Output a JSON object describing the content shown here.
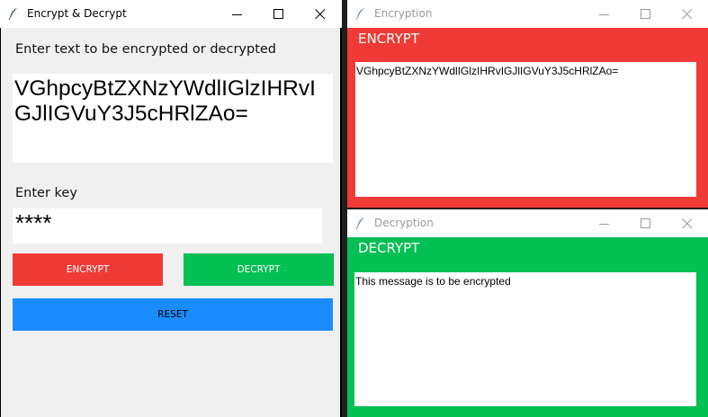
{
  "main_window": {
    "title": "Encrypt & Decrypt",
    "text_label": "Enter text to be encrypted or decrypted",
    "text_value": "VGhpcyBtZXNzYWdlIGlzIHRvIGJlIGVuY3J5cHRlZAo=",
    "key_label": "Enter key",
    "key_value": "****",
    "encrypt_button": "ENCRYPT",
    "decrypt_button": "DECRYPT",
    "reset_button": "RESET"
  },
  "encryption_window": {
    "title": "Encryption",
    "heading": "ENCRYPT",
    "result": "VGhpcyBtZXNzYWdlIGlzIHRvIGJlIGVuY3J5cHRlZAo="
  },
  "decryption_window": {
    "title": "Decryption",
    "heading": "DECRYPT",
    "result": "This message is to be encrypted"
  },
  "colors": {
    "encrypt": "#ef3a36",
    "decrypt": "#03bf54",
    "reset": "#1a8cff",
    "window_bg": "#f0f0f0"
  },
  "icons": [
    "feather-icon",
    "minimize-icon",
    "maximize-icon",
    "close-icon"
  ]
}
